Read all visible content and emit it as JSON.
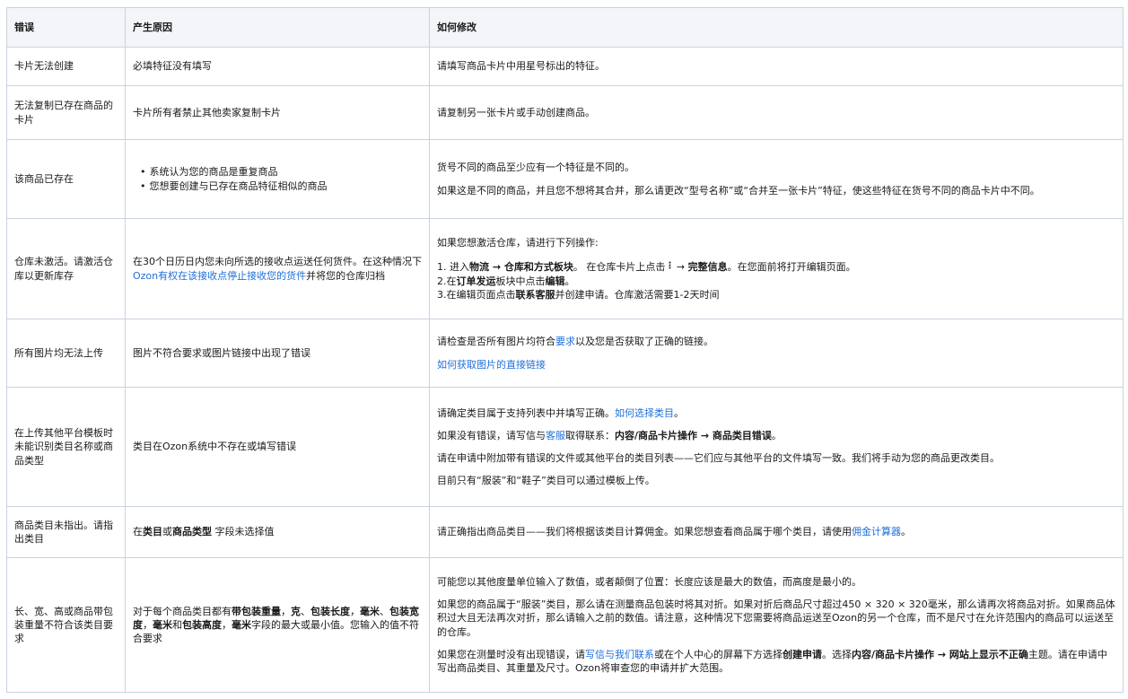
{
  "headers": {
    "col1": "错误",
    "col2": "产生原因",
    "col3": "如何修改"
  },
  "rows": [
    {
      "error": "卡片无法创建",
      "cause": "必填特征没有填写",
      "fix": "请填写商品卡片中用星号标出的特征。"
    },
    {
      "error": "无法复制已存在商品的卡片",
      "cause": "卡片所有者禁止其他卖家复制卡片",
      "fix": "请复制另一张卡片或手动创建商品。"
    },
    {
      "error": "该商品已存在",
      "cause_list": [
        "系统认为您的商品是重复商品",
        "您想要创建与已存在商品特征相似的商品"
      ],
      "fix_p1": "货号不同的商品至少应有一个特征是不同的。",
      "fix_p2": "如果这是不同的商品，并且您不想将其合并，那么请更改“型号名称”或“合并至一张卡片”特征，使这些特征在货号不同的商品卡片中不同。"
    },
    {
      "error": "仓库未激活。请激活仓库以更新库存",
      "cause_a": "在30个日历日内您未向所选的接收点运送任何货件。在这种情况下",
      "cause_link": "Ozon有权在该接收点停止接收您的货件",
      "cause_b": "并将您的仓库归档",
      "fix_intro": "如果您想激活仓库，请进行下列操作:",
      "step1_a": "1. 进入",
      "step1_b1": "物流 → 仓库和方式板块",
      "step1_c": "。 在仓库卡片上点击",
      "step1_icon": "⋮",
      "step1_d": " → ",
      "step1_b2": "完整信息",
      "step1_e": "。在您面前将打开编辑页面。",
      "step2_a": "2.在",
      "step2_b1": "订单发运",
      "step2_c": "板块中点击",
      "step2_b2": "编辑",
      "step2_d": "。",
      "step3_a": "3.在编辑页面点击",
      "step3_b": "联系客服",
      "step3_c": "并创建申请。仓库激活需要1-2天时间"
    },
    {
      "error": "所有图片均无法上传",
      "cause": "图片不符合要求或图片链接中出现了错误",
      "fix_a": "请检查是否所有图片均符合",
      "fix_link": "要求",
      "fix_b": "以及您是否获取了正确的链接。",
      "fix_link2": "如何获取图片的直接链接"
    },
    {
      "error": "在上传其他平台模板时未能识别类目名称或商品类型",
      "cause": "类目在Ozon系统中不存在或填写错误",
      "p1_a": "请确定类目属于支持列表中并填写正确。",
      "p1_link": "如何选择类目",
      "p1_b": "。",
      "p2_a": "如果没有错误，请写信与",
      "p2_link": "客服",
      "p2_b": "取得联系：",
      "p2_bold": "内容/商品卡片操作 → 商品类目错误",
      "p2_c": "。",
      "p3": "请在申请中附加带有错误的文件或其他平台的类目列表——它们应与其他平台的文件填写一致。我们将手动为您的商品更改类目。",
      "p4": "目前只有“服装”和“鞋子”类目可以通过模板上传。"
    },
    {
      "error": "商品类目未指出。请指出类目",
      "cause_a": "在",
      "cause_b1": "类目",
      "cause_b": "或",
      "cause_b2": "商品类型",
      "cause_c": " 字段未选择值",
      "fix_a": "请正确指出商品类目——我们将根据该类目计算佣金。如果您想查看商品属于哪个类目，请使用",
      "fix_link": "佣金计算器",
      "fix_b": "。"
    },
    {
      "error": "长、宽、高或商品带包装重量不符合该类目要求",
      "cause_a": "对于每个商品类目都有",
      "cause_b1": "带包装重量",
      "cause_s1": "，",
      "cause_b2": "克",
      "cause_s2": "、",
      "cause_b3": "包装长度",
      "cause_s3": "，",
      "cause_b4": "毫米",
      "cause_s4": "、",
      "cause_b5": "包装宽度",
      "cause_s5": "，",
      "cause_b6": "毫米",
      "cause_s6": "和",
      "cause_b7": "包装高度",
      "cause_s7": "，",
      "cause_b8": "毫米",
      "cause_c": "字段的最大或最小值。您输入的值不符合要求",
      "p1": "可能您以其他度量单位输入了数值，或者颠倒了位置：长度应该是最大的数值，而高度是最小的。",
      "p2": "如果您的商品属于“服装”类目，那么请在测量商品包装时将其对折。如果对折后商品尺寸超过450 × 320 × 320毫米，那么请再次将商品对折。如果商品体积过大且无法再次对折，那么请输入之前的数值。请注意，这种情况下您需要将商品运送至Ozon的另一个仓库，而不是尺寸在允许范围内的商品可以运送至的仓库。",
      "p3_a": "如果您在测量时没有出现错误，请",
      "p3_link": "写信与我们联系",
      "p3_b": "或在个人中心的屏幕下方选择",
      "p3_bold1": "创建申请",
      "p3_c": "。选择",
      "p3_bold2": "内容/商品卡片操作 → 网站上显示不正确",
      "p3_d": "主题。请在申请中写出商品类目、其重量及尺寸。Ozon将审查您的申请并扩大范围。"
    }
  ]
}
